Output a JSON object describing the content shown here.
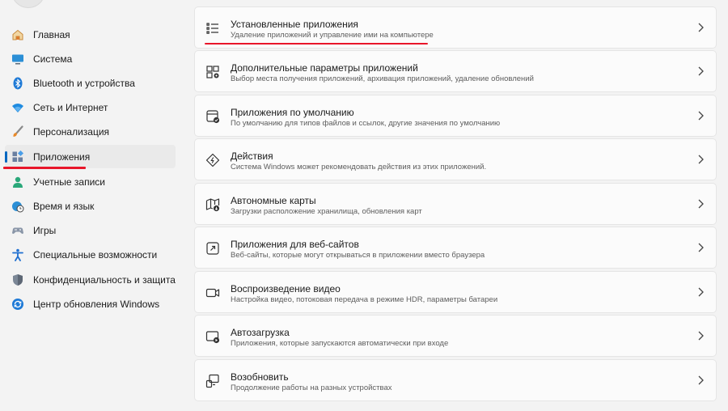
{
  "sidebar": {
    "items": [
      {
        "label": "Главная",
        "icon": "home-icon"
      },
      {
        "label": "Система",
        "icon": "display-icon"
      },
      {
        "label": "Bluetooth и устройства",
        "icon": "bluetooth-icon"
      },
      {
        "label": "Сеть и Интернет",
        "icon": "wifi-icon"
      },
      {
        "label": "Персонализация",
        "icon": "brush-icon"
      },
      {
        "label": "Приложения",
        "icon": "apps-icon",
        "selected": true
      },
      {
        "label": "Учетные записи",
        "icon": "user-icon"
      },
      {
        "label": "Время и язык",
        "icon": "globe-clock-icon"
      },
      {
        "label": "Игры",
        "icon": "gamepad-icon"
      },
      {
        "label": "Специальные возможности",
        "icon": "accessibility-icon"
      },
      {
        "label": "Конфиденциальность и защита",
        "icon": "shield-icon"
      },
      {
        "label": "Центр обновления Windows",
        "icon": "update-icon"
      }
    ]
  },
  "main": {
    "cards": [
      {
        "title": "Установленные приложения",
        "subtitle": "Удаление приложений и управление ими на компьютере",
        "icon": "list-icon"
      },
      {
        "title": "Дополнительные параметры приложений",
        "subtitle": "Выбор места получения приложений, архивация приложений, удаление обновлений",
        "icon": "apps-settings-icon"
      },
      {
        "title": "Приложения по умолчанию",
        "subtitle": "По умолчанию для типов файлов и ссылок, другие значения по умолчанию",
        "icon": "default-apps-icon"
      },
      {
        "title": "Действия",
        "subtitle": "Система Windows может рекомендовать действия из этих приложений.",
        "icon": "actions-icon"
      },
      {
        "title": "Автономные карты",
        "subtitle": "Загрузки расположение хранилища, обновления карт",
        "icon": "offline-map-icon"
      },
      {
        "title": "Приложения для веб-сайтов",
        "subtitle": "Веб-сайты, которые могут открываться в приложении вместо браузера",
        "icon": "open-external-icon"
      },
      {
        "title": "Воспроизведение видео",
        "subtitle": "Настройка видео, потоковая передача в режиме HDR, параметры батареи",
        "icon": "video-icon"
      },
      {
        "title": "Автозагрузка",
        "subtitle": "Приложения, которые запускаются автоматически при входе",
        "icon": "startup-icon"
      },
      {
        "title": "Возобновить",
        "subtitle": "Продолжение работы на разных устройствах",
        "icon": "resume-icon"
      }
    ]
  },
  "colors": {
    "accent": "#0067c0",
    "annotation": "#e8162a"
  }
}
